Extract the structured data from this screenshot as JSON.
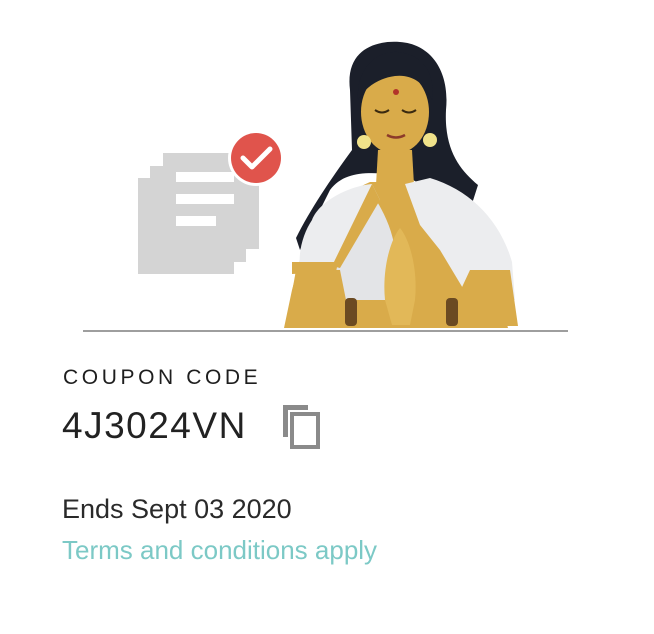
{
  "illustration": {
    "doc_icon": "document-icon",
    "check_icon": "check-badge-icon",
    "figure": "woman-namaste-illustration",
    "colors": {
      "doc": "#d4d4d4",
      "check_badge": "#e0544c",
      "divider": "#9e9e9e"
    }
  },
  "coupon": {
    "label": "COUPON CODE",
    "code": "4J3024VN",
    "copy_icon": "copy-icon"
  },
  "expiry": {
    "text": "Ends Sept 03 2020"
  },
  "terms": {
    "text": "Terms and conditions apply",
    "color": "#7cc9c6"
  }
}
